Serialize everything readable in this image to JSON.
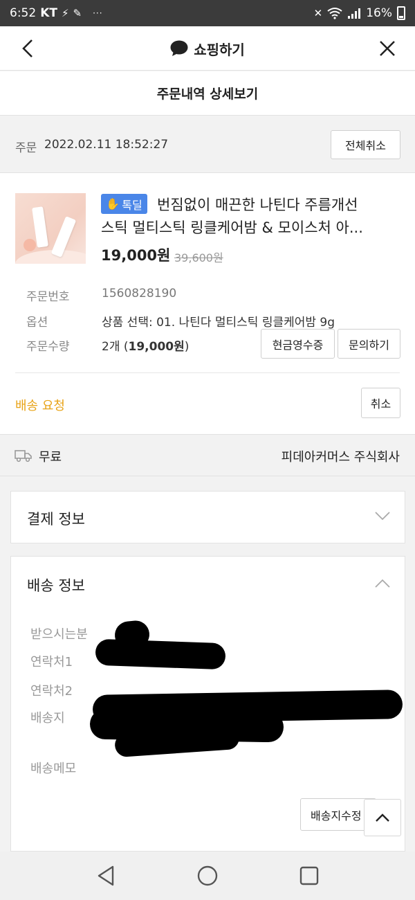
{
  "status_bar": {
    "time": "6:52",
    "carrier": "KT",
    "battery": "16%"
  },
  "header": {
    "title": "쇼핑하기"
  },
  "subheader": {
    "title": "주문내역 상세보기"
  },
  "order": {
    "date_label": "주문",
    "date_value": "2022.02.11 18:52:27",
    "cancel_all_label": "전체취소"
  },
  "product": {
    "badge": "톡딜",
    "name_line1": "번짐없이 매끈한 나틴다 주름개선",
    "name_line2": "스틱 멀티스틱 링클케어밤 & 모이스처 아...",
    "price": "19,000원",
    "original_price": "39,600원",
    "order_number_label": "주문번호",
    "order_number": "1560828190",
    "option_label": "옵션",
    "option_value": "상품 선택: 01. 나틴다 멀티스틱 링클케어밤 9g",
    "quantity_label": "주문수량",
    "quantity_prefix": "2개 (",
    "quantity_price": "19,000원",
    "quantity_suffix": ")",
    "receipt_button": "현금영수증",
    "inquiry_button": "문의하기",
    "shipping_status": "배송 요청",
    "cancel_button": "취소"
  },
  "shipping_fee": {
    "label": "무료",
    "seller": "피데아커머스 주식회사"
  },
  "payment_section": {
    "title": "결제 정보"
  },
  "delivery_section": {
    "title": "배송 정보",
    "recipient_label": "받으시는분",
    "contact1_label": "연락처1",
    "contact2_label": "연락처2",
    "address_label": "배송지",
    "memo_label": "배송메모",
    "change_address_button": "배송지수정"
  },
  "colors": {
    "badge": "#4a86e8",
    "shipping_status": "#e8a317"
  }
}
